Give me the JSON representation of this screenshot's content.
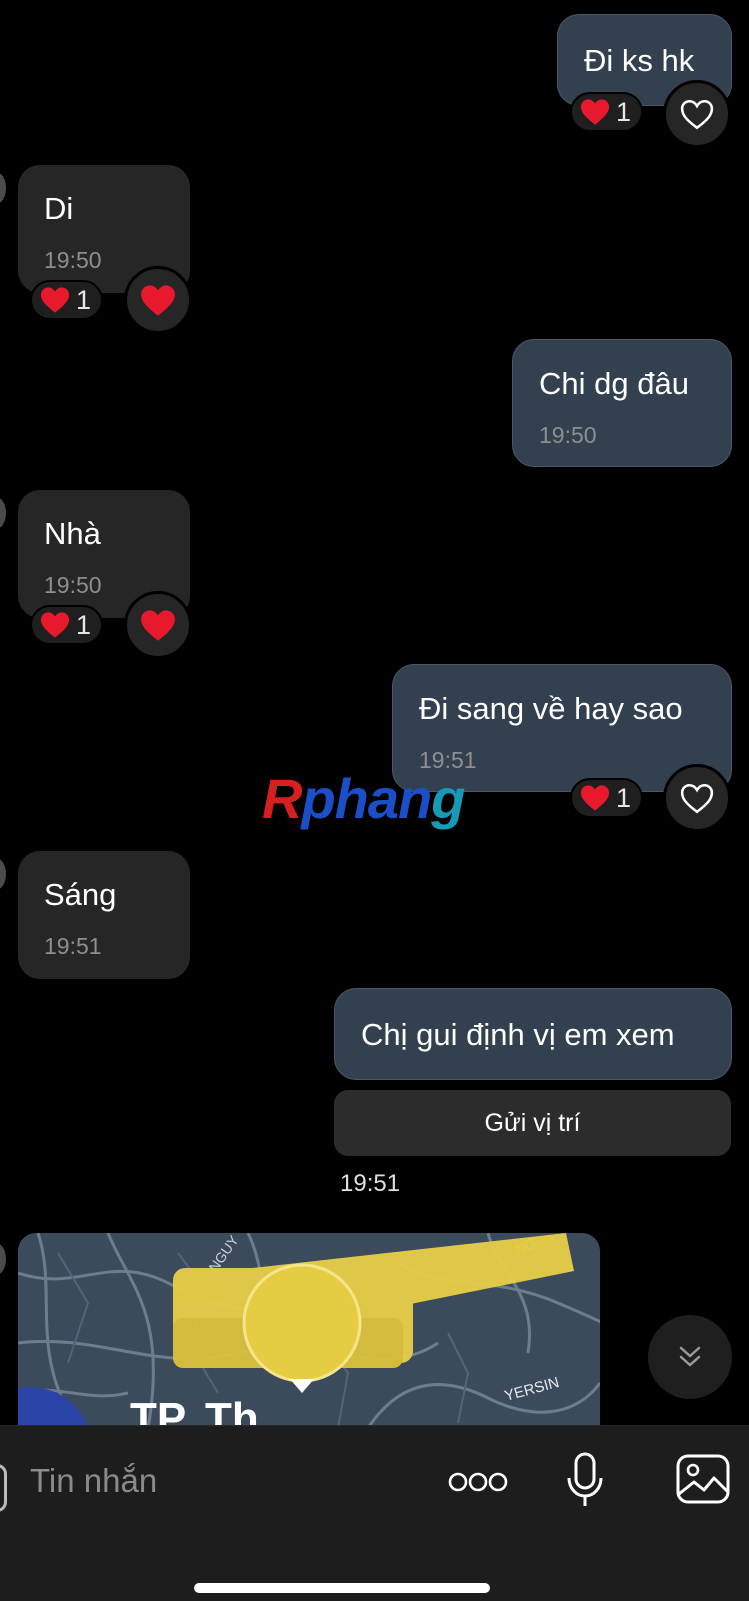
{
  "messages": [
    {
      "dir": "out",
      "text": "Đi ks hk",
      "reaction_count": "1"
    },
    {
      "dir": "in",
      "text": "Di",
      "time": "19:50",
      "reaction_count": "1"
    },
    {
      "dir": "out",
      "text": "Chi dg đâu",
      "time": "19:50"
    },
    {
      "dir": "in",
      "text": "Nhà",
      "time": "19:50",
      "reaction_count": "1"
    },
    {
      "dir": "out",
      "text": "Đi sang về hay sao",
      "time": "19:51",
      "reaction_count": "1"
    },
    {
      "dir": "in",
      "text": "Sáng",
      "time": "19:51"
    },
    {
      "dir": "out",
      "text": "Chị gui định vị em xem"
    }
  ],
  "location_request": {
    "button_label": "Gửi vị trí",
    "time": "19:51"
  },
  "map": {
    "labels": [
      "NGUY",
      "NG",
      "YERSIN",
      "TP. Th"
    ]
  },
  "watermark": {
    "part1": "R",
    "part2": "phan",
    "part3": "g"
  },
  "composer": {
    "placeholder": "Tin nhắn"
  },
  "icons": {
    "heart": "heart-icon",
    "heart_outline": "heart-outline-icon",
    "more": "more-options-icon",
    "mic": "microphone-icon",
    "image": "image-icon",
    "scroll": "chevron-double-down-icon"
  },
  "colors": {
    "outgoing_bubble": "#33404f",
    "incoming_bubble": "#262626",
    "heart": "#e8192c"
  }
}
